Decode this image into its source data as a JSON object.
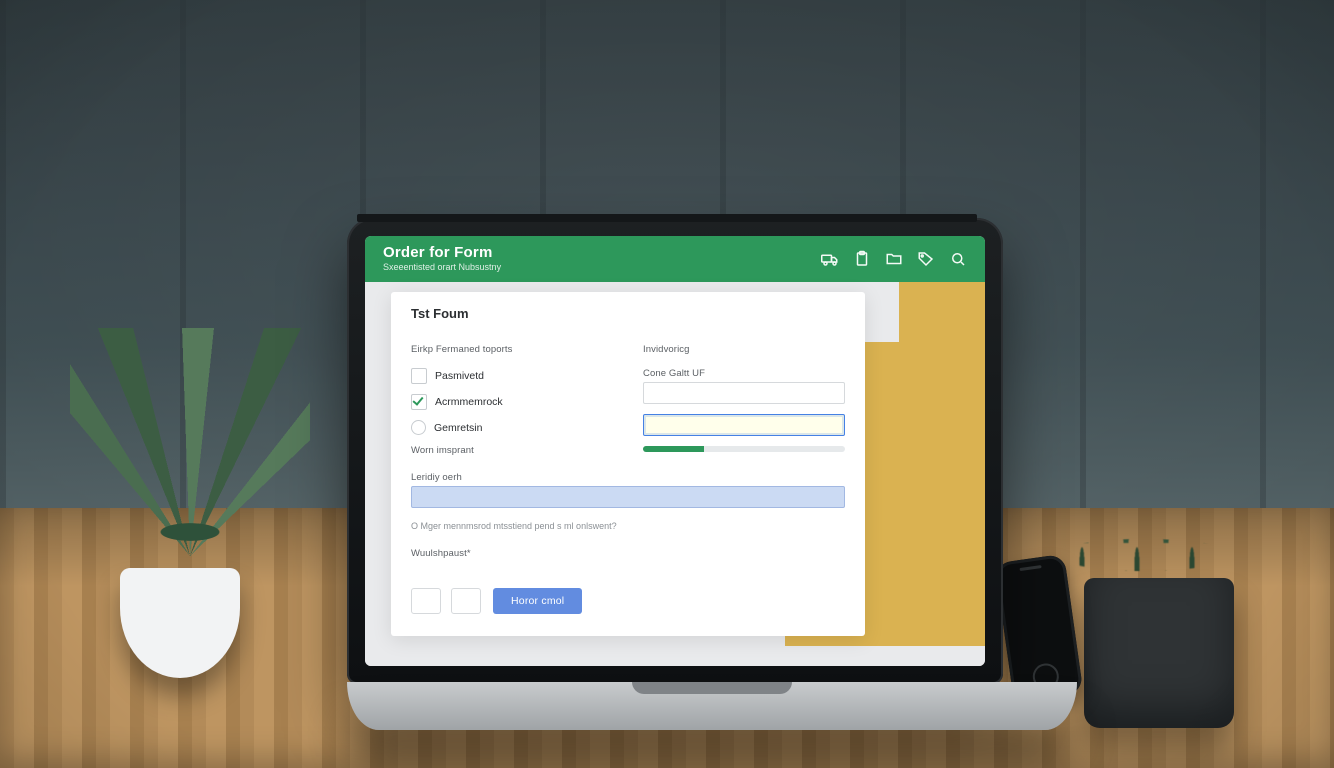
{
  "header": {
    "title": "Order for Form",
    "subtitle": "Sxeeentisted orart Nubsustny",
    "icons": [
      "truck-icon",
      "clipboard-icon",
      "folder-icon",
      "tag-icon",
      "search-icon"
    ]
  },
  "form": {
    "section_title": "Tst Foum",
    "left": {
      "group_label": "Eirkp Fermaned toports",
      "check1_label": "Pasmivetd",
      "check2_label": "Acrmmemrock",
      "radio1_label": "Gemretsin",
      "spacer_label": "Worn imsprant"
    },
    "right": {
      "group_label": "Invidvoricg",
      "field1_label": "Cone Galtt UF",
      "progress_pct": 30
    },
    "wide": {
      "slider_label": "Leridiy oerh",
      "hint": "O Mger mennmsrod mtsstiend pend s ml onlswent?",
      "required_note": "Wuulshpaust*"
    },
    "buttons": {
      "primary": "Horor cmol"
    }
  }
}
